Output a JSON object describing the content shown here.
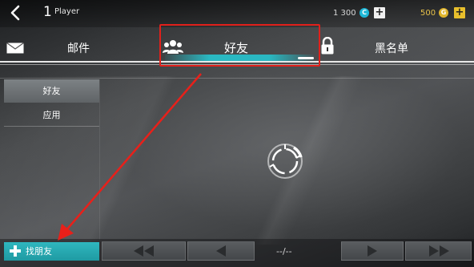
{
  "player": {
    "level": "1",
    "name": "Player"
  },
  "currency": {
    "credits": "1 300",
    "gold": "500",
    "credit_glyph": "C",
    "gold_glyph": "G"
  },
  "tabs": [
    {
      "label": "邮件",
      "icon": "mail-icon"
    },
    {
      "label": "好友",
      "icon": "friends-icon",
      "active": true
    },
    {
      "label": "黑名单",
      "icon": "lock-icon"
    }
  ],
  "sidebar": {
    "items": [
      {
        "label": "好友",
        "active": true
      },
      {
        "label": "应用"
      }
    ]
  },
  "bottom": {
    "find_friend": "找朋友",
    "page_info": "--/--"
  },
  "colors": {
    "accent": "#1fb8c4",
    "highlight": "#e0201b",
    "gold": "#e8bf2c"
  }
}
